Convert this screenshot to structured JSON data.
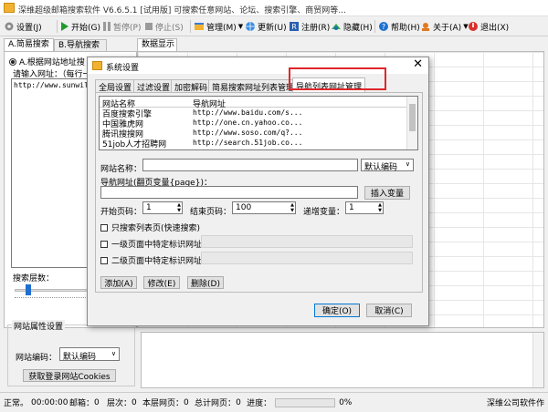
{
  "window": {
    "title": "深维超级邮箱搜索软件 V6.6.5.1 [试用版] 可搜索任意网站、论坛、搜索引擎、商贸网等..."
  },
  "toolbar": {
    "settings": "设置(J)",
    "start": "开始(G)",
    "pause": "暂停(P)",
    "stop": "停止(S)",
    "manage": "管理(M)",
    "update": "更新(U)",
    "register": "注册(R)",
    "hide": "隐藏(H)",
    "help": "帮助(H)",
    "about": "关于(A)",
    "exit": "退出(X)"
  },
  "left_panel": {
    "tabs": [
      "A.简易搜索",
      "B.导航搜索"
    ],
    "mode_radio": "A.根据网站地址搜",
    "url_label": "请输入网址：（每行一",
    "url_value": "http://www.sunwill",
    "depth_label": "搜索层数：",
    "site_props_title": "网站属性设置",
    "encoding_label": "网站编码：",
    "encoding_value": "默认编码",
    "cookies_button": "获取登录网站Cookies"
  },
  "main": {
    "data_tab": "数据显示"
  },
  "dialog": {
    "title": "系统设置",
    "tabs": [
      "全局设置",
      "过滤设置",
      "加密解码",
      "简易搜索网址列表管理",
      "导航列表网址管理"
    ],
    "table_headers": [
      "网站名称",
      "导航网址"
    ],
    "table_rows": [
      [
        "百度搜索引擎",
        "http://www.baidu.com/s..."
      ],
      [
        "中国雅虎网",
        "http://one.cn.yahoo.co..."
      ],
      [
        "腾讯搜搜网",
        "http://www.soso.com/q?..."
      ],
      [
        "51job人才招聘网",
        "http://search.51job.co..."
      ]
    ],
    "site_name_label": "网站名称：",
    "site_name_value": "",
    "encoding_select": "默认编码",
    "nav_url_label": "导航网址(翻页变量{page})：",
    "nav_url_value": "",
    "insert_var_button": "插入变量",
    "start_page_label": "开始页码：",
    "start_page_value": "1",
    "end_page_label": "结束页码：",
    "end_page_value": "100",
    "step_label": "递增变量：",
    "step_value": "1",
    "cb_list_only": "只搜索列表页(快速搜索)",
    "cb_level1": "一级页面中特定标识网址",
    "cb_level2": "二级页面中特定标识网址",
    "add_button": "添加(A)",
    "edit_button": "修改(E)",
    "delete_button": "删除(D)",
    "ok_button": "确定(O)",
    "cancel_button": "取消(C)"
  },
  "status": {
    "state": "正常。",
    "time": "00:00:00",
    "emails_label": "邮箱：",
    "emails": "0",
    "level_label": "层次：",
    "level": "0",
    "page_label": "本层网页：",
    "page": "0",
    "total_label": "总计网页：",
    "total": "0",
    "progress_label": "进度：",
    "progress_text": "0%",
    "progress": 0,
    "company": "深维公司软件作"
  },
  "colors": {
    "highlight_box": "#e0262a",
    "title_bar": "#ffffff",
    "dialog_bg": "#f0f0f0"
  }
}
